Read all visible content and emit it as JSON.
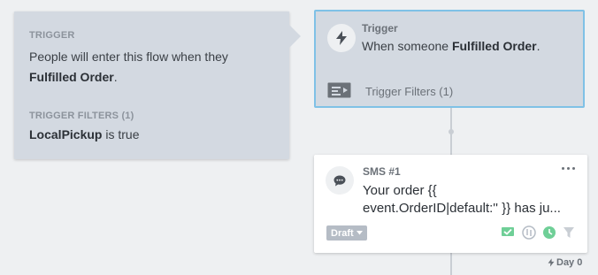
{
  "info_panel": {
    "trigger_heading": "TRIGGER",
    "trigger_text_prefix": "People will enter this flow when they",
    "trigger_metric": "Fulfilled Order",
    "trigger_text_suffix": ".",
    "filters_heading": "TRIGGER FILTERS (1)",
    "filter_property": "LocalPickup",
    "filter_condition": " is true"
  },
  "trigger_node": {
    "title": "Trigger",
    "desc_prefix": "When someone ",
    "desc_metric": "Fulfilled Order",
    "desc_suffix": ".",
    "filters_label": "Trigger Filters (1)",
    "icon": "lightning-bolt-icon"
  },
  "sms_node": {
    "title": "SMS #1",
    "body_line1": "Your order {{",
    "body_line2": "event.OrderID|default:'' }} has ju...",
    "status_label": "Draft",
    "icon": "chat-bubble-icon",
    "status_icons": [
      "sms-verified-icon",
      "attachment-icon",
      "smart-sending-icon",
      "filter-icon"
    ]
  },
  "day_label": "Day 0",
  "colors": {
    "accent_green": "#6fcf97",
    "selected_border": "#7fc1e6",
    "panel_bg": "#d3d9e1"
  }
}
